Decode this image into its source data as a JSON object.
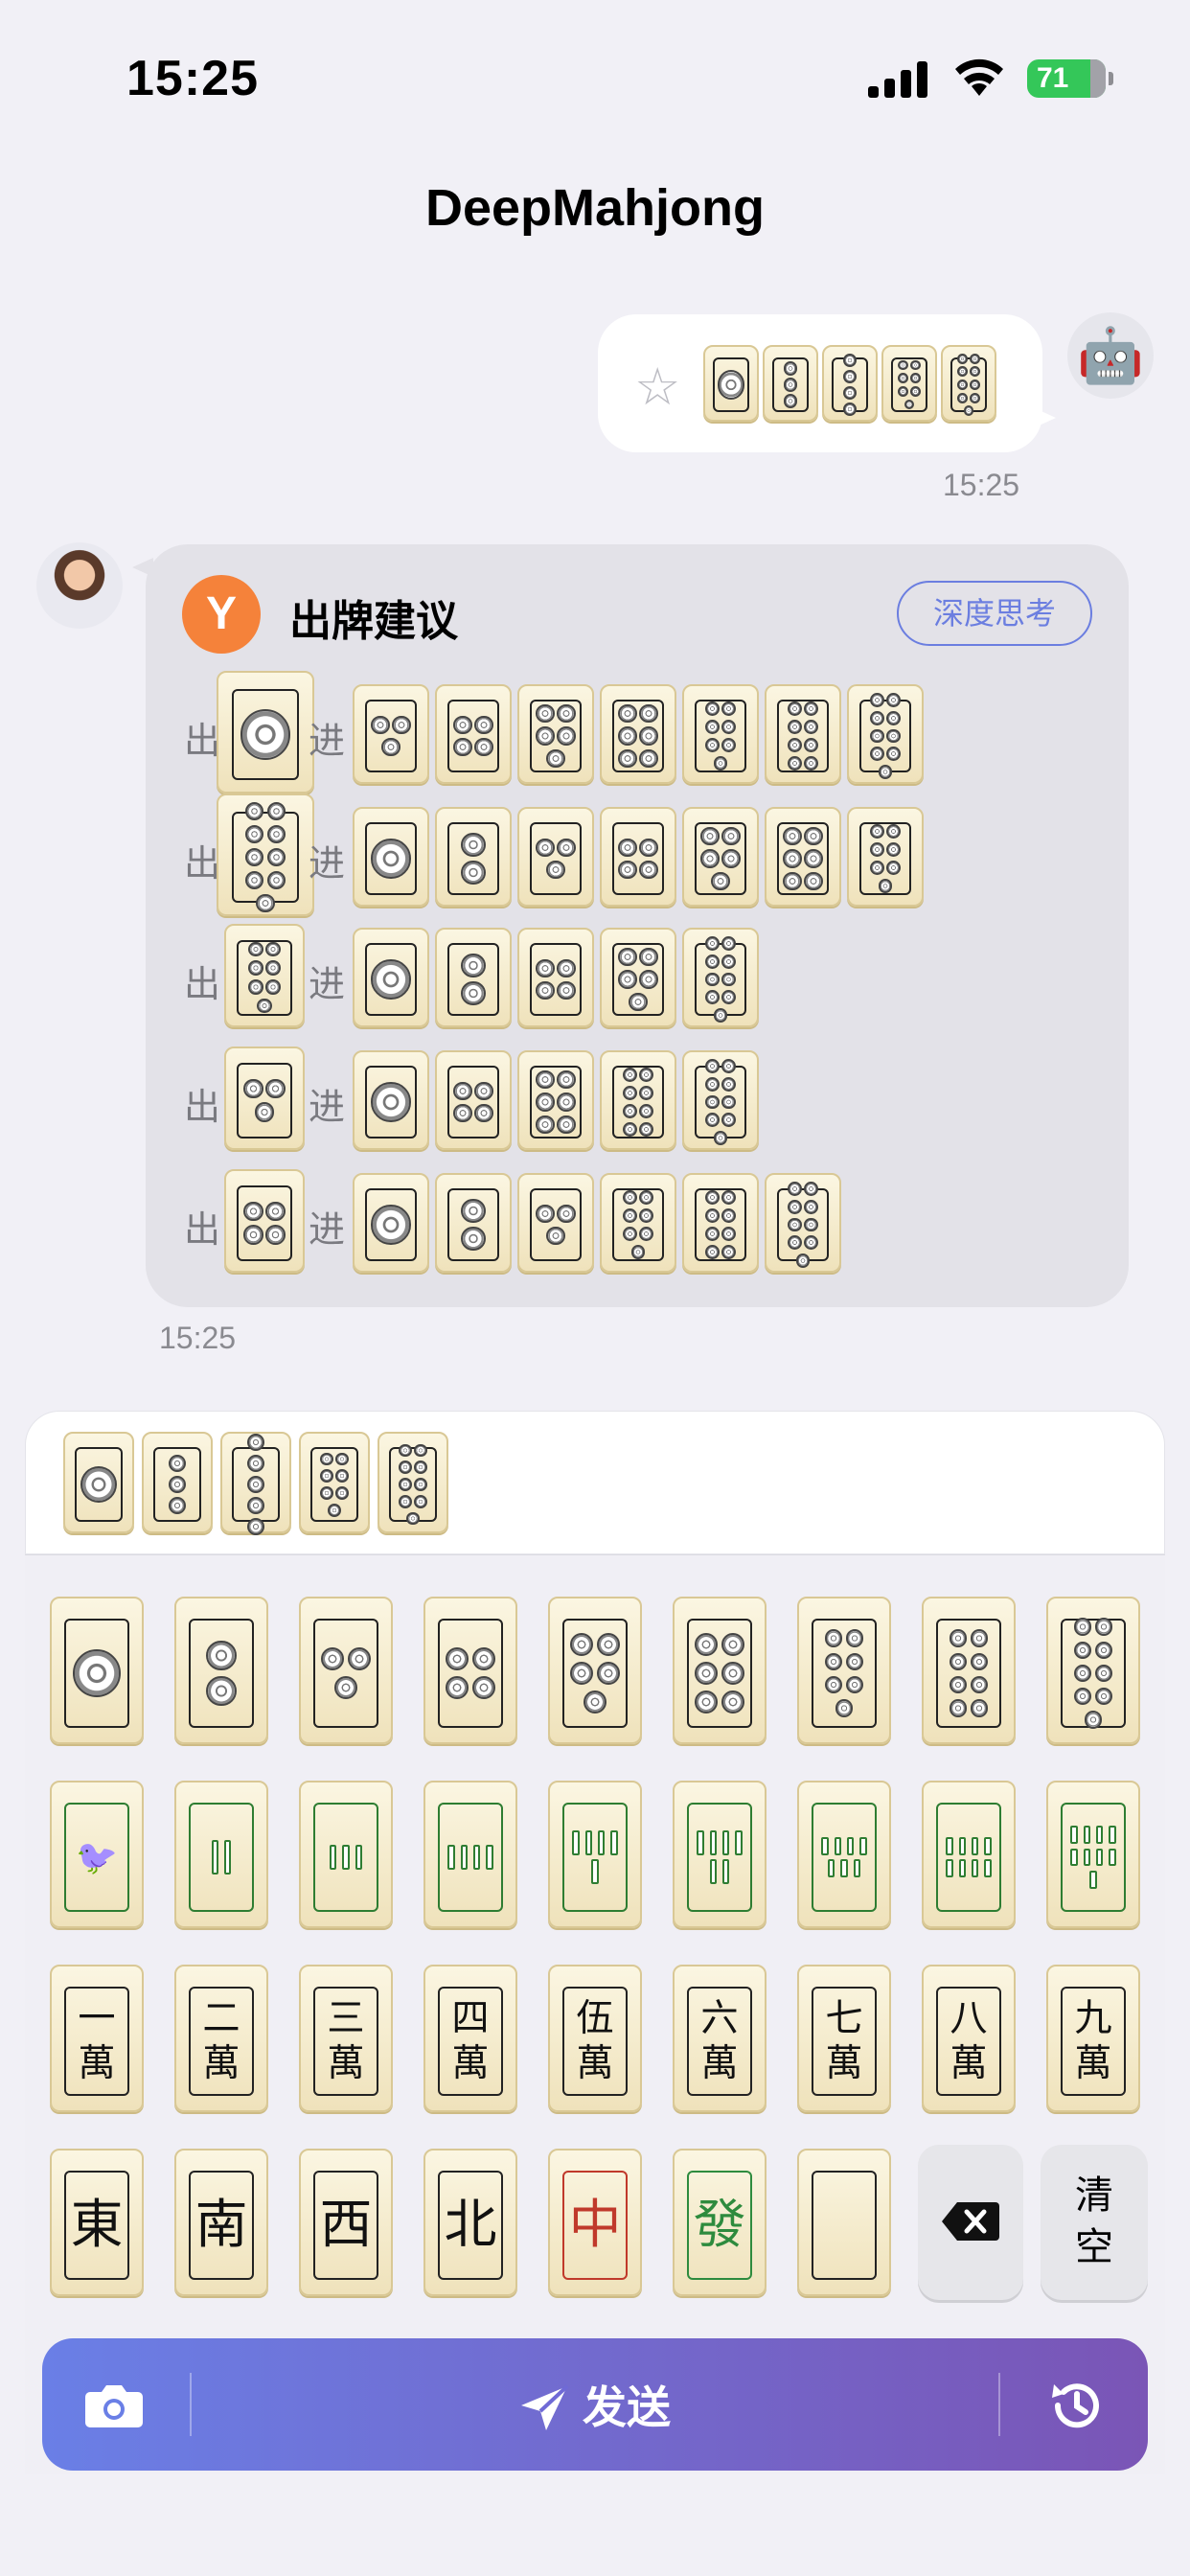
{
  "status": {
    "time": "15:25",
    "battery": "71"
  },
  "title": "DeepMahjong",
  "user_message": {
    "tiles": [
      {
        "suit": "dots",
        "n": 1
      },
      {
        "suit": "dots",
        "n": 3
      },
      {
        "suit": "dots",
        "n": 4
      },
      {
        "suit": "dots",
        "n": 7
      },
      {
        "suit": "dots",
        "n": 9
      }
    ],
    "time": "15:25"
  },
  "suggestion": {
    "title": "出牌建议",
    "think_button": "深度思考",
    "discard_label": "出",
    "draw_label": "进",
    "rows": [
      {
        "out": {
          "suit": "dots",
          "n": 1
        },
        "in": [
          {
            "suit": "dots",
            "n": 3
          },
          {
            "suit": "dots",
            "n": 4
          },
          {
            "suit": "dots",
            "n": 5
          },
          {
            "suit": "dots",
            "n": 6
          },
          {
            "suit": "dots",
            "n": 7
          },
          {
            "suit": "dots",
            "n": 8
          },
          {
            "suit": "dots",
            "n": 9
          }
        ]
      },
      {
        "out": {
          "suit": "dots",
          "n": 9
        },
        "in": [
          {
            "suit": "dots",
            "n": 1
          },
          {
            "suit": "dots",
            "n": 2
          },
          {
            "suit": "dots",
            "n": 3
          },
          {
            "suit": "dots",
            "n": 4
          },
          {
            "suit": "dots",
            "n": 5
          },
          {
            "suit": "dots",
            "n": 6
          },
          {
            "suit": "dots",
            "n": 7
          }
        ]
      },
      {
        "out": {
          "suit": "dots",
          "n": 7
        },
        "in": [
          {
            "suit": "dots",
            "n": 1
          },
          {
            "suit": "dots",
            "n": 2
          },
          {
            "suit": "dots",
            "n": 4
          },
          {
            "suit": "dots",
            "n": 5
          },
          {
            "suit": "dots",
            "n": 9
          }
        ]
      },
      {
        "out": {
          "suit": "dots",
          "n": 3
        },
        "in": [
          {
            "suit": "dots",
            "n": 1
          },
          {
            "suit": "dots",
            "n": 4
          },
          {
            "suit": "dots",
            "n": 6
          },
          {
            "suit": "dots",
            "n": 8
          },
          {
            "suit": "dots",
            "n": 9
          }
        ]
      },
      {
        "out": {
          "suit": "dots",
          "n": 4
        },
        "in": [
          {
            "suit": "dots",
            "n": 1
          },
          {
            "suit": "dots",
            "n": 2
          },
          {
            "suit": "dots",
            "n": 3
          },
          {
            "suit": "dots",
            "n": 7
          },
          {
            "suit": "dots",
            "n": 8
          },
          {
            "suit": "dots",
            "n": 9
          }
        ]
      }
    ],
    "time": "15:25"
  },
  "input_tiles": [
    {
      "suit": "dots",
      "n": 1
    },
    {
      "suit": "dots",
      "n": 3
    },
    {
      "suit": "dots",
      "n": 5
    },
    {
      "suit": "dots",
      "n": 7
    },
    {
      "suit": "dots",
      "n": 9
    }
  ],
  "keyboard": {
    "dots": [
      1,
      2,
      3,
      4,
      5,
      6,
      7,
      8,
      9
    ],
    "bamboo": [
      1,
      2,
      3,
      4,
      5,
      6,
      7,
      8,
      9
    ],
    "characters": [
      "一",
      "二",
      "三",
      "四",
      "伍",
      "六",
      "七",
      "八",
      "九"
    ],
    "characters_suffix": "萬",
    "honors": [
      {
        "char": "東",
        "color": "#111111"
      },
      {
        "char": "南",
        "color": "#111111"
      },
      {
        "char": "西",
        "color": "#111111"
      },
      {
        "char": "北",
        "color": "#111111"
      },
      {
        "char": "中",
        "color": "#c0392b"
      },
      {
        "char": "發",
        "color": "#2e8b3e"
      },
      {
        "char": "",
        "color": "#111111"
      }
    ],
    "clear_label": "清空"
  },
  "send_bar": {
    "send_label": "发送",
    "camera_icon": "camera-icon",
    "history_icon": "history-icon"
  },
  "colors": {
    "accent": "#6b7ee0",
    "orange": "#f5823a",
    "bamboo_green": "#2e7d32"
  }
}
